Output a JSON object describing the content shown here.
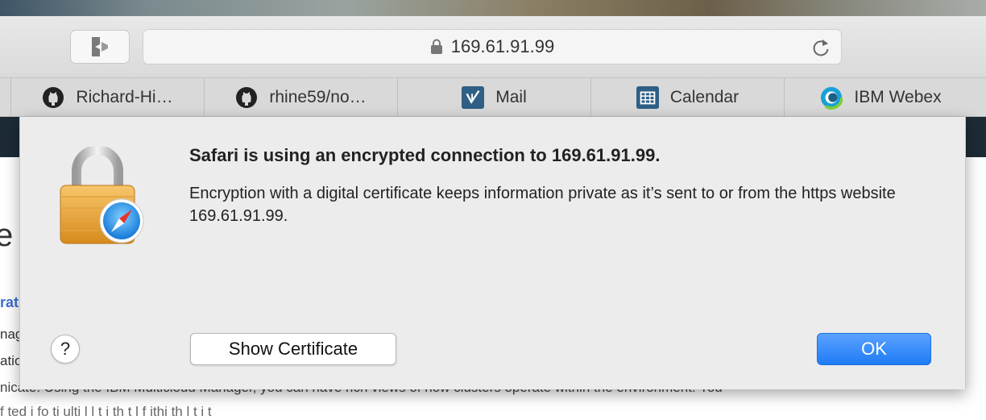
{
  "toolbar": {
    "address": "169.61.91.99"
  },
  "favorites": [
    {
      "label": "Richard-Hi…",
      "icon": "github-icon"
    },
    {
      "label": "rhine59/no…",
      "icon": "github-icon"
    },
    {
      "label": "Mail",
      "icon": "mail-app-icon"
    },
    {
      "label": "Calendar",
      "icon": "calendar-app-icon"
    },
    {
      "label": "IBM Webex",
      "icon": "webex-icon"
    }
  ],
  "page_background": {
    "heading_fragment": "e t",
    "link_fragment": "rati",
    "line1": "nag",
    "line2": "atio",
    "line3": "nicate. Using the IBM Multicloud Manager, you can have rich views of how clusters operate within the environment. You",
    "line4": "f                              ted i fo       ti                              ulti l     l      t          i      th t       l       f                       ithi   th       l      t                 i        t"
  },
  "dialog": {
    "title": "Safari is using an encrypted connection to 169.61.91.99.",
    "body": "Encryption with a digital certificate keeps information private as it’s sent to or from the https website 169.61.91.99.",
    "help_label": "?",
    "show_certificate_label": "Show Certificate",
    "ok_label": "OK"
  },
  "colors": {
    "ok_button": "#1f7cf5",
    "page_header": "#1d2b36",
    "link": "#3a6fd1"
  }
}
